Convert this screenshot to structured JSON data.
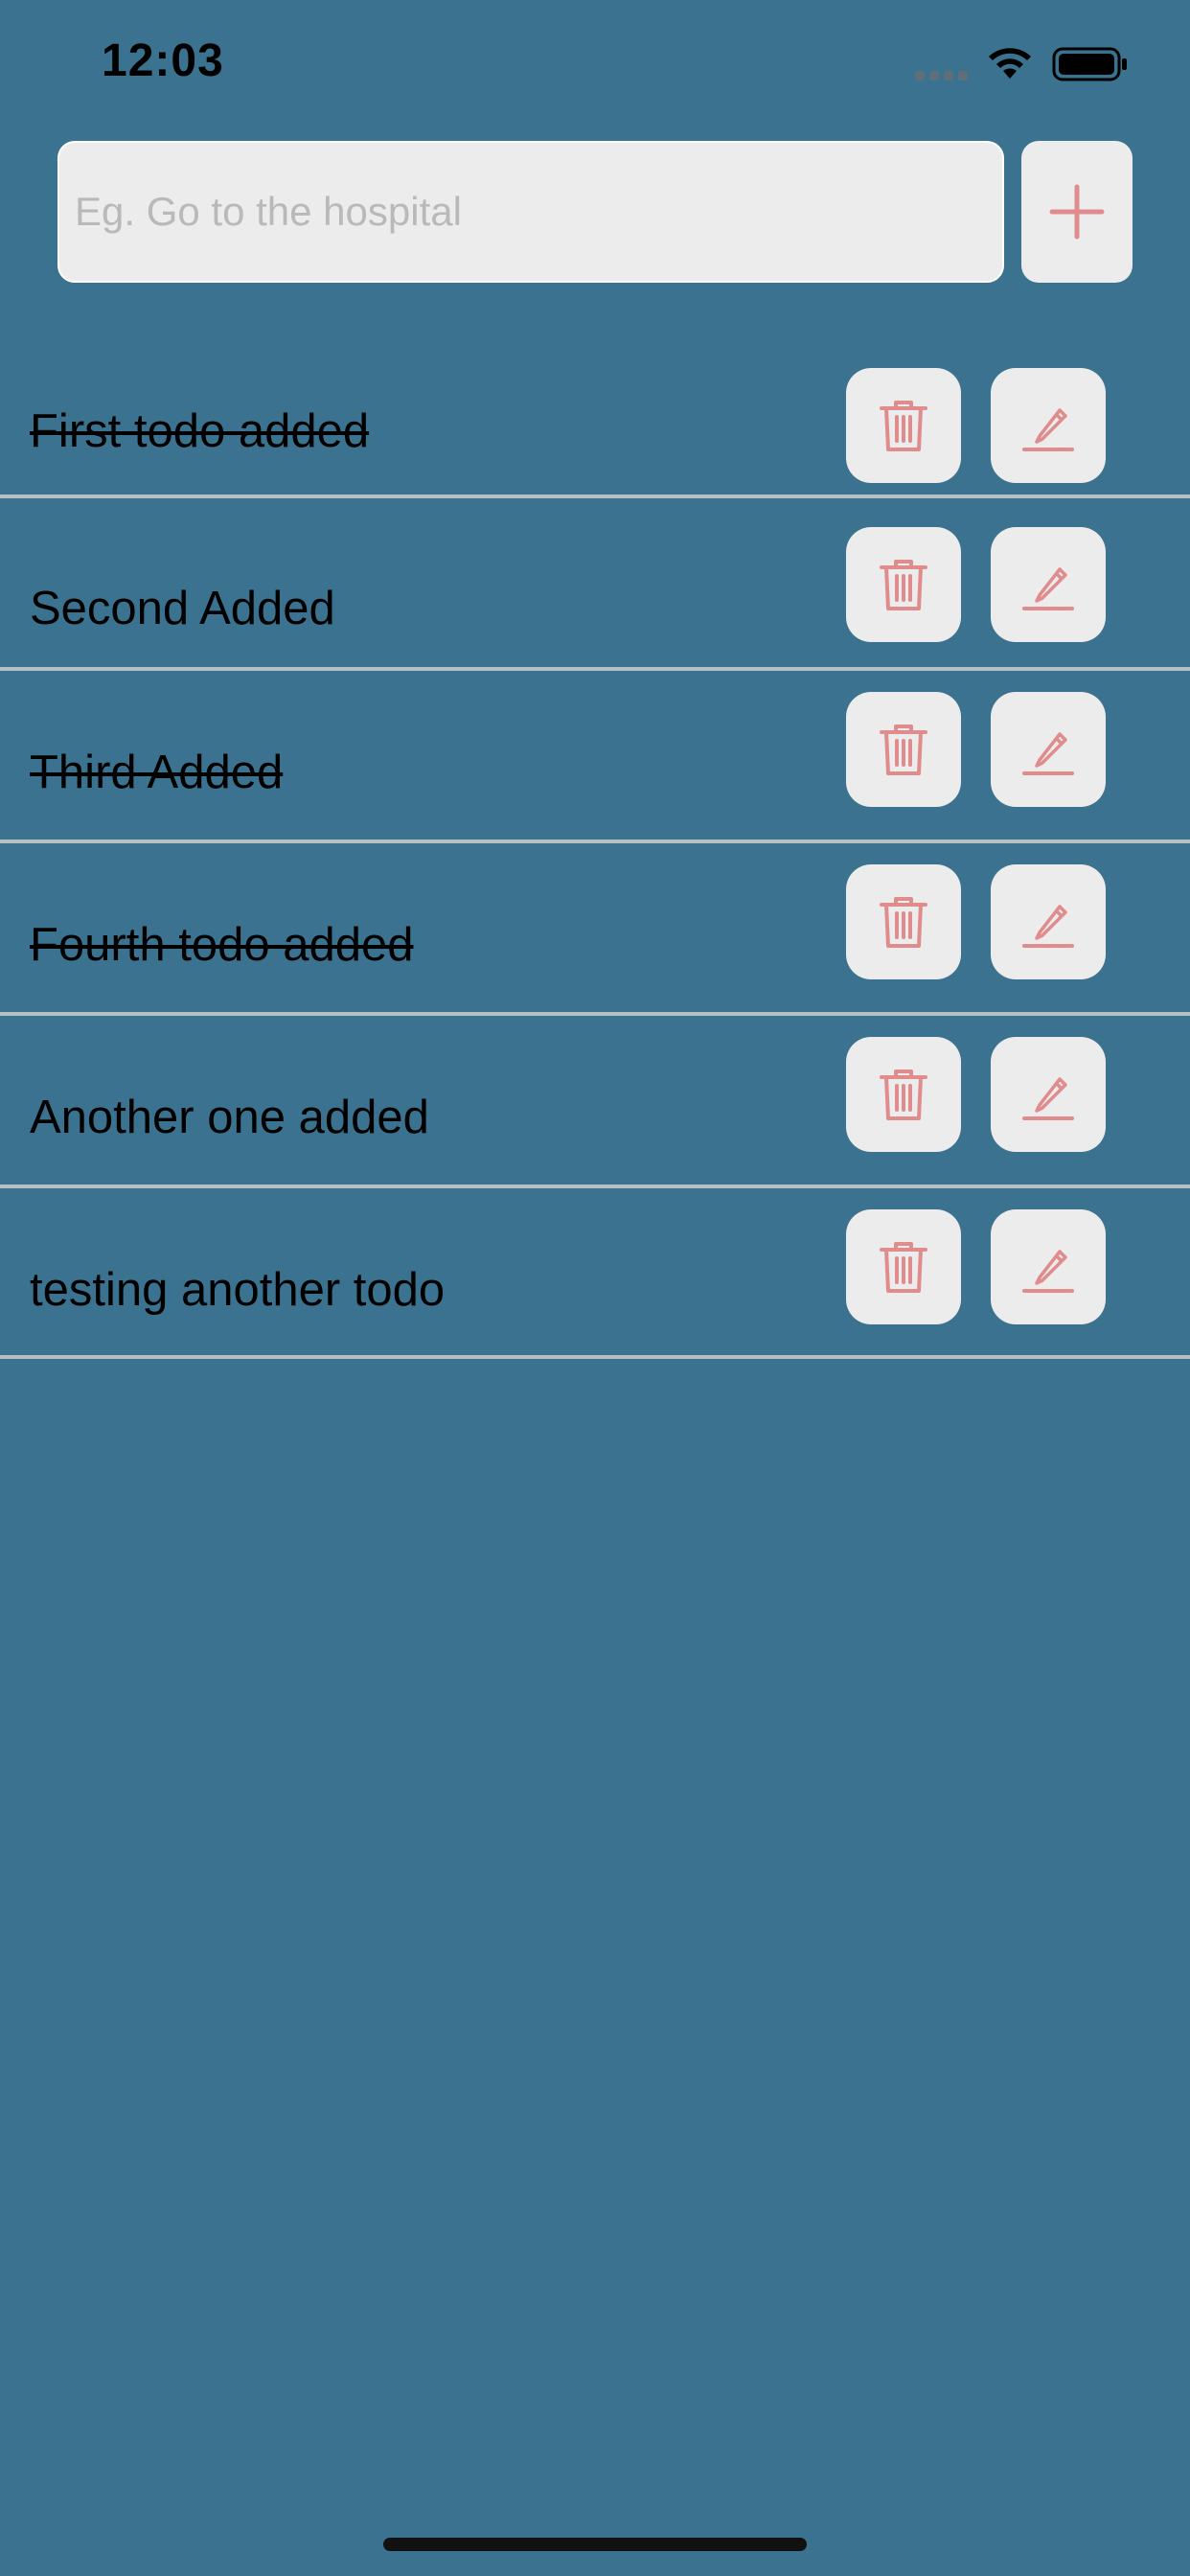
{
  "status_bar": {
    "time": "12:03"
  },
  "input": {
    "placeholder": "Eg. Go to the hospital",
    "value": ""
  },
  "colors": {
    "background": "#3b728f",
    "button_bg": "#ececec",
    "icon_accent": "#e08c8c"
  },
  "todos": [
    {
      "text": "First todo added",
      "completed": true
    },
    {
      "text": "Second Added",
      "completed": false
    },
    {
      "text": "Third Added",
      "completed": true
    },
    {
      "text": "Fourth todo added",
      "completed": true
    },
    {
      "text": "Another one added",
      "completed": false
    },
    {
      "text": "testing another todo",
      "completed": false
    }
  ],
  "icons": {
    "add": "plus-icon",
    "delete": "trash-icon",
    "edit": "pencil-icon"
  }
}
